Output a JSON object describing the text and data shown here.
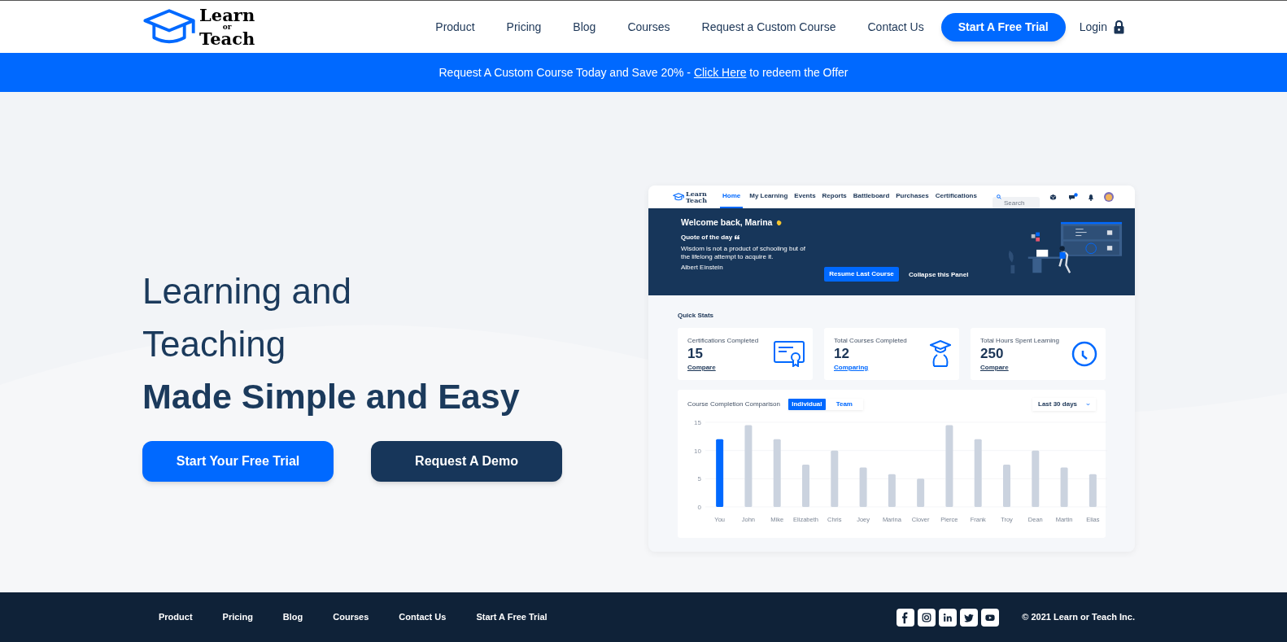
{
  "header": {
    "logo": [
      "Learn",
      "or",
      "Teach"
    ],
    "nav": [
      "Product",
      "Pricing",
      "Blog",
      "Courses",
      "Request a Custom Course",
      "Contact Us"
    ],
    "cta": "Start A Free Trial",
    "login": "Login"
  },
  "banner": {
    "before": "Request A Custom Course Today and Save 20% - ",
    "link": "Click Here",
    "after": " to redeem the Offer"
  },
  "hero": {
    "lines": [
      "Learning and",
      "Teaching"
    ],
    "headline": "Made Simple and Easy",
    "buttons": [
      {
        "label": "Start Your Free Trial",
        "kind": "primary"
      },
      {
        "label": "Request A Demo",
        "kind": "dark"
      }
    ]
  },
  "preview": {
    "logo": [
      "Learn",
      "Teach"
    ],
    "nav": [
      {
        "label": "Home",
        "selected": true
      },
      {
        "label": "My Learning",
        "selected": false
      },
      {
        "label": "Events",
        "selected": false
      },
      {
        "label": "Reports",
        "selected": false
      },
      {
        "label": "Battleboard",
        "selected": false
      },
      {
        "label": "Purchases",
        "selected": false
      },
      {
        "label": "Certifications",
        "selected": false
      }
    ],
    "search": {
      "placeholder": "Search"
    },
    "welcome": "Welcome back, Marina",
    "quote_label": "Quote of the day",
    "quote": "Wisdom is not a product of schooling but of the lifelong attempt to acquire it.",
    "author": "Albert Einstein",
    "resume": "Resume Last Course",
    "collapse": "Collapse this Panel",
    "stats_title": "Quick Stats",
    "stats": [
      {
        "kind": "certificate",
        "label": "Certifications Completed",
        "value": "15",
        "link": "Compare",
        "active": false
      },
      {
        "kind": "graduate",
        "label": "Total Courses Completed",
        "value": "12",
        "link": "Comparing",
        "active": true
      },
      {
        "kind": "clock",
        "label": "Total Hours Spent Learning",
        "value": "250",
        "link": "Compare",
        "active": false
      }
    ],
    "chart_card": {
      "title": "Course Completion Comparison",
      "toggle": [
        {
          "label": "Individual",
          "selected": true
        },
        {
          "label": "Team",
          "selected": false
        }
      ],
      "range": "Last 30 days",
      "chart_data": {
        "type": "bar",
        "stacked": true,
        "categories": [
          "You",
          "John",
          "Mike",
          "Elizabeth",
          "Chris",
          "Joey",
          "Marina",
          "Clover",
          "Pierce",
          "Frank",
          "Troy",
          "Dean",
          "Martin",
          "Elias"
        ],
        "series": [
          {
            "color": "#0069ff",
            "values": [
              12,
              null,
              null,
              null,
              null,
              null,
              null,
              null,
              null,
              null,
              null,
              null,
              null,
              null
            ]
          },
          {
            "color": "#cbd3df",
            "values": [
              null,
              14.5,
              12,
              7.5,
              10,
              7,
              5.8,
              5,
              14.5,
              12,
              7.5,
              10,
              7,
              5.8
            ]
          }
        ],
        "ylim": [
          0,
          15
        ],
        "yticks": [
          0,
          5,
          10,
          15
        ]
      }
    }
  },
  "footer": {
    "links": [
      "Product",
      "Pricing",
      "Blog",
      "Courses",
      "Contact Us",
      "Start A Free Trial"
    ],
    "copyright": "© 2021 Learn or Teach Inc."
  }
}
